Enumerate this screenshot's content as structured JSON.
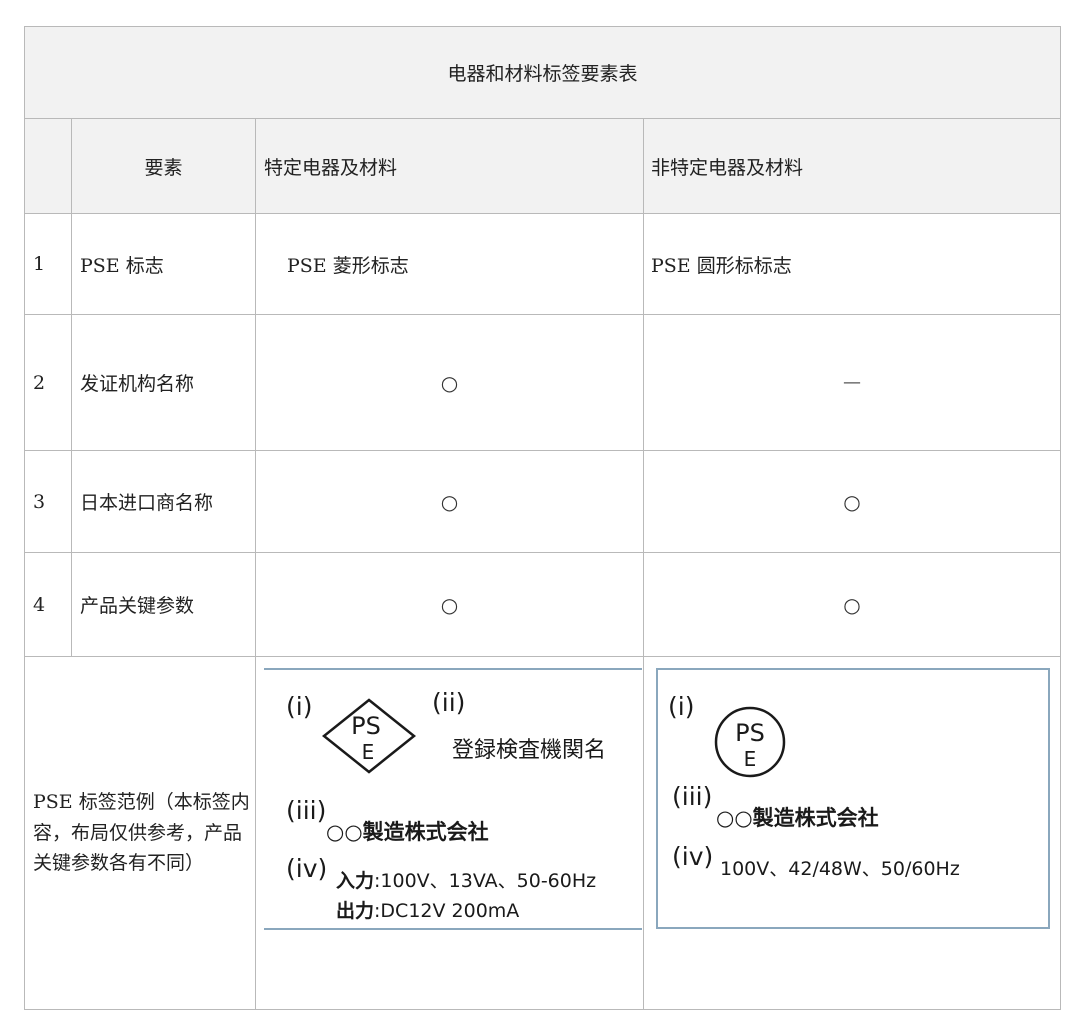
{
  "table": {
    "title": "电器和材料标签要素表",
    "headers": {
      "element": "要素",
      "specified": "特定电器及材料",
      "non_specified": "非特定电器及材料"
    },
    "rows": [
      {
        "no": "1",
        "element": "PSE 标志",
        "specified": "PSE 菱形标志",
        "non_specified": "PSE 圆形标标志"
      },
      {
        "no": "2",
        "element": "发证机构名称",
        "specified": "○",
        "non_specified": "—"
      },
      {
        "no": "3",
        "element": "日本进口商名称",
        "specified": "○",
        "non_specified": "○"
      },
      {
        "no": "4",
        "element": "产品关键参数",
        "specified": "○",
        "non_specified": "○"
      }
    ],
    "example_label": "PSE 标签范例（本标签内容，布局仅供参考，产品关键参数各有不同）"
  },
  "label_specified": {
    "i": "(i)",
    "ii": "(ii)",
    "iii": "(iii)",
    "iv": "(iv)",
    "logo_text_top": "PS",
    "logo_text_bottom": "E",
    "inspection_body": "登録検査機関名",
    "company": "○○製造株式会社",
    "input_label": "入力",
    "input_value": ":100V、13VA、50-60Hz",
    "output_label": "出力",
    "output_value": ":DC12V 200mA"
  },
  "label_non_specified": {
    "i": "(i)",
    "iii": "(iii)",
    "iv": "(iv)",
    "logo_text_top": "PS",
    "logo_text_bottom": "E",
    "company": "○○製造株式会社",
    "rating": "100V、42/48W、50/60Hz"
  }
}
